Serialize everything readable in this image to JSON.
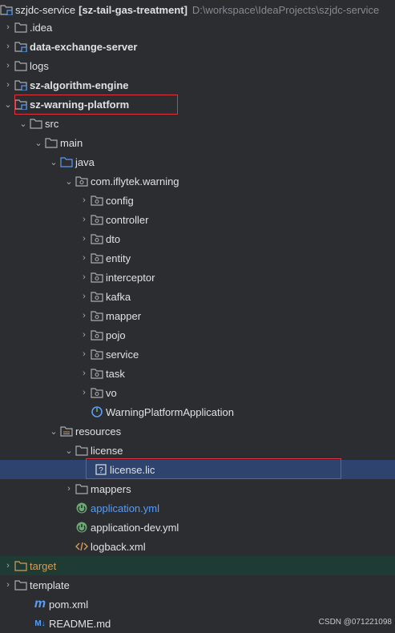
{
  "tree": {
    "root": {
      "name": "szjdc-service",
      "bracket": "[sz-tail-gas-treatment]",
      "path": "D:\\workspace\\IdeaProjects\\szjdc-service"
    },
    "idea": ".idea",
    "data_exchange": "data-exchange-server",
    "logs": "logs",
    "algorithm_engine": "sz-algorithm-engine",
    "warning_platform": "sz-warning-platform",
    "src": "src",
    "main": "main",
    "java": "java",
    "package": "com.iflytek.warning",
    "pkg_items": [
      "config",
      "controller",
      "dto",
      "entity",
      "interceptor",
      "kafka",
      "mapper",
      "pojo",
      "service",
      "task",
      "vo"
    ],
    "app_class": "WarningPlatformApplication",
    "resources": "resources",
    "license_folder": "license",
    "license_file": "license.lic",
    "mappers": "mappers",
    "application_yml": "application.yml",
    "application_dev_yml": "application-dev.yml",
    "logback": "logback.xml",
    "target": "target",
    "template": "template",
    "pom": "pom.xml",
    "readme": "README.md"
  },
  "watermark": "CSDN @071221098",
  "colors": {
    "accent": "#589df6",
    "highlight": "#e0343a",
    "selection": "#2e436e"
  }
}
